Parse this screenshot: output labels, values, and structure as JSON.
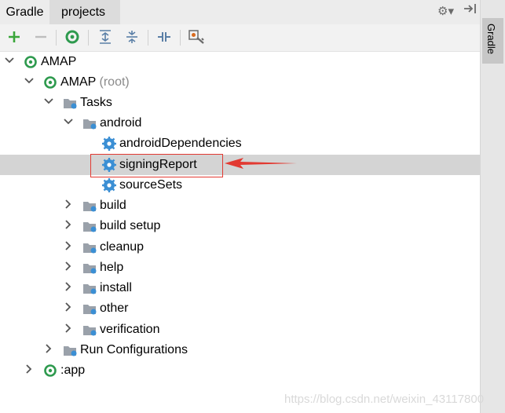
{
  "header": {
    "tab_gradle": "Gradle",
    "tab_projects": "projects"
  },
  "side_strip": {
    "tab_label": "Gradle"
  },
  "toolbar": {
    "icons": [
      "add-icon",
      "remove-icon",
      "refresh-icon",
      "expand-all-icon",
      "collapse-all-icon",
      "toggle-offline-icon",
      "settings-icon"
    ],
    "add_color": "#3aa63a"
  },
  "tree": {
    "rows": [
      {
        "label": "AMAP",
        "suffix": "",
        "icon": "gradle-icon",
        "expanded": true
      },
      {
        "label": "AMAP",
        "suffix": "(root)",
        "icon": "gradle-icon",
        "expanded": true
      },
      {
        "label": "Tasks",
        "suffix": "",
        "icon": "folder-icon",
        "expanded": true
      },
      {
        "label": "android",
        "suffix": "",
        "icon": "folder-icon",
        "expanded": true
      },
      {
        "label": "androidDependencies",
        "suffix": "",
        "icon": "gear-icon"
      },
      {
        "label": "signingReport",
        "suffix": "",
        "icon": "gear-icon",
        "selected": true
      },
      {
        "label": "sourceSets",
        "suffix": "",
        "icon": "gear-icon"
      },
      {
        "label": "build",
        "suffix": "",
        "icon": "folder-icon",
        "expanded": false
      },
      {
        "label": "build setup",
        "suffix": "",
        "icon": "folder-icon",
        "expanded": false
      },
      {
        "label": "cleanup",
        "suffix": "",
        "icon": "folder-icon",
        "expanded": false
      },
      {
        "label": "help",
        "suffix": "",
        "icon": "folder-icon",
        "expanded": false
      },
      {
        "label": "install",
        "suffix": "",
        "icon": "folder-icon",
        "expanded": false
      },
      {
        "label": "other",
        "suffix": "",
        "icon": "folder-icon",
        "expanded": false
      },
      {
        "label": "verification",
        "suffix": "",
        "icon": "folder-icon",
        "expanded": false
      },
      {
        "label": "Run Configurations",
        "suffix": "",
        "icon": "folder-icon",
        "expanded": false
      },
      {
        "label": ":app",
        "suffix": "",
        "icon": "gradle-icon",
        "expanded": false
      }
    ]
  },
  "colors": {
    "gradle_green": "#2e9a4e",
    "gear_blue": "#3b8fd4",
    "highlight_red": "#e23a32",
    "selection": "#d4d4d4"
  },
  "watermark": "https://blog.csdn.net/weixin_43117800"
}
